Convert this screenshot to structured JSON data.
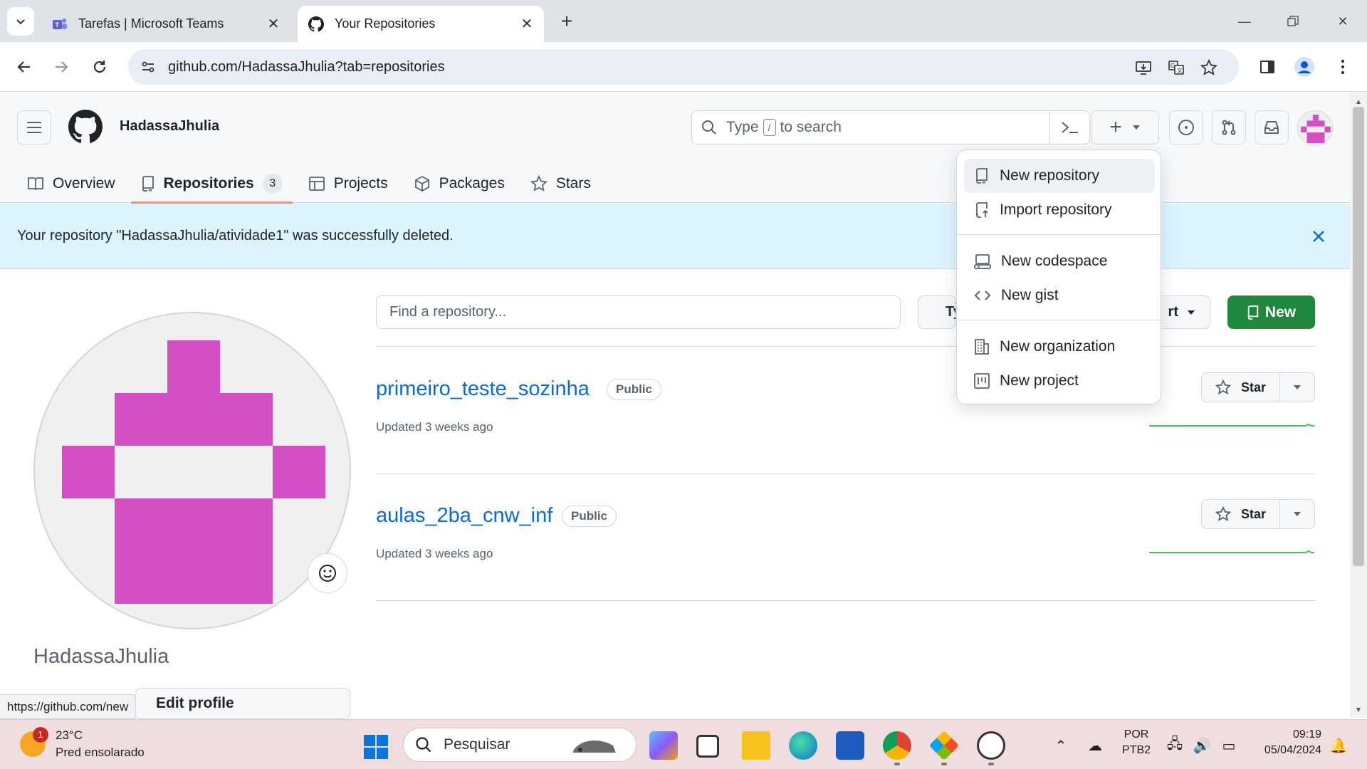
{
  "browser": {
    "tabs": [
      {
        "title": "Tarefas | Microsoft Teams",
        "active": false
      },
      {
        "title": "Your Repositories",
        "active": true
      }
    ],
    "url": "github.com/HadassaJhulia?tab=repositories"
  },
  "header": {
    "username": "HadassaJhulia",
    "search_prefix": "Type",
    "search_key": "/",
    "search_suffix": "to search",
    "plus_label": "+"
  },
  "profile_tabs": [
    {
      "label": "Overview",
      "icon": "book-icon"
    },
    {
      "label": "Repositories",
      "icon": "repo-icon",
      "count": "3",
      "selected": true
    },
    {
      "label": "Projects",
      "icon": "table-icon"
    },
    {
      "label": "Packages",
      "icon": "package-icon"
    },
    {
      "label": "Stars",
      "icon": "star-icon"
    }
  ],
  "flash": {
    "message": "Your repository \"HadassaJhulia/atividade1\" was successfully deleted."
  },
  "repo_filter": {
    "placeholder": "Find a repository...",
    "type_label": "Typ",
    "sort_label": "rt",
    "new_label": "New"
  },
  "repos": [
    {
      "name": "primeiro_teste_sozinha",
      "visibility": "Public",
      "updated": "Updated 3 weeks ago",
      "star_label": "Star"
    },
    {
      "name": "aulas_2ba_cnw_inf",
      "visibility": "Public",
      "updated": "Updated 3 weeks ago",
      "star_label": "Star"
    }
  ],
  "profile": {
    "name": "HadassaJhulia",
    "edit_label": "Edit profile"
  },
  "status_bar_url": "https://github.com/new",
  "create_menu": {
    "items": [
      {
        "label": "New repository",
        "icon": "repo-icon"
      },
      {
        "label": "Import repository",
        "icon": "repo-push-icon"
      },
      {
        "label": "New codespace",
        "icon": "codespaces-icon"
      },
      {
        "label": "New gist",
        "icon": "code-icon"
      },
      {
        "label": "New organization",
        "icon": "organization-icon"
      },
      {
        "label": "New project",
        "icon": "project-icon"
      }
    ]
  },
  "taskbar": {
    "weather_temp": "23°C",
    "weather_desc": "Pred ensolarado",
    "weather_badge": "1",
    "search_label": "Pesquisar",
    "lang_line1": "POR",
    "lang_line2": "PTB2",
    "time": "09:19",
    "date": "05/04/2024"
  },
  "colors": {
    "accent_green": "#1f883d",
    "link_blue": "#0969da",
    "flash_bg": "#ddf4ff",
    "avatar_magenta": "#d64ec5",
    "tab_underline": "#fd8c73"
  }
}
